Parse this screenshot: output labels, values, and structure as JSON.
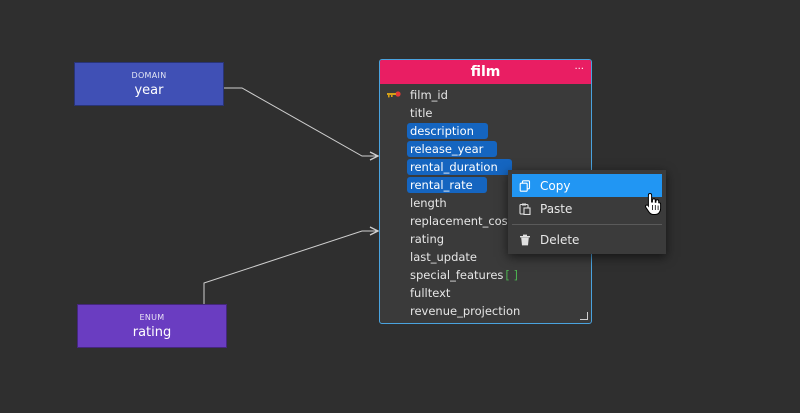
{
  "nodes": {
    "domain": {
      "kind": "DOMAIN",
      "name": "year",
      "color": "#4050b5"
    },
    "enum": {
      "kind": "ENUM",
      "name": "rating",
      "color": "#6a3dc1"
    }
  },
  "table": {
    "title": "film",
    "header_color": "#e91e63",
    "border_color": "#4aa3df",
    "menu_glyph": "···",
    "fields": [
      {
        "name": "film_id",
        "primary_key": true,
        "selected": false
      },
      {
        "name": "title",
        "selected": false
      },
      {
        "name": "description",
        "selected": true
      },
      {
        "name": "release_year",
        "selected": true
      },
      {
        "name": "rental_duration",
        "selected": true
      },
      {
        "name": "rental_rate",
        "selected": true
      },
      {
        "name": "length",
        "selected": false
      },
      {
        "name": "replacement_cost",
        "selected": false
      },
      {
        "name": "rating",
        "selected": false
      },
      {
        "name": "last_update",
        "selected": false
      },
      {
        "name": "special_features",
        "array_marker": "[ ]",
        "selected": false
      },
      {
        "name": "fulltext",
        "selected": false
      },
      {
        "name": "revenue_projection",
        "selected": false
      }
    ]
  },
  "context_menu": {
    "items": [
      {
        "label": "Copy",
        "icon": "copy-icon",
        "active": true
      },
      {
        "label": "Paste",
        "icon": "paste-icon",
        "active": false
      },
      {
        "label": "Delete",
        "icon": "trash-icon",
        "active": false
      }
    ],
    "accent": "#2196f3"
  },
  "selection_color": "#1565c0"
}
